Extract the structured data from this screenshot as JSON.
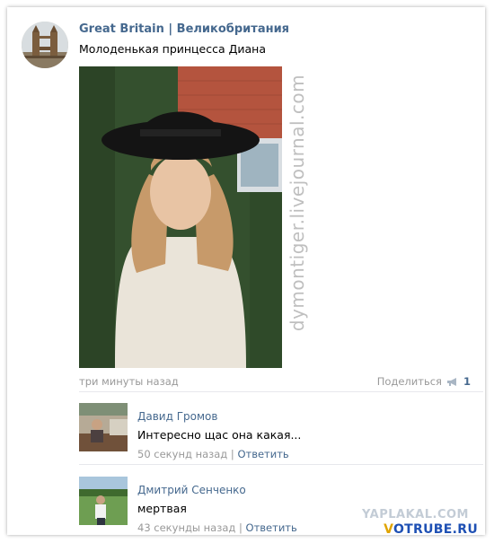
{
  "post": {
    "group_name": "Great Britain | Великобритания",
    "text": "Молоденькая принцесса Диана",
    "photo_watermark": "dymontiger.livejournal.com",
    "time": "три минуты назад",
    "share_label": "Поделиться",
    "share_count": "1"
  },
  "comments": [
    {
      "author": "Давид Громов",
      "text": "Интересно щас она какая...",
      "time": "50 секунд назад",
      "separator": "|",
      "reply_label": "Ответить"
    },
    {
      "author": "Дмитрий Сенченко",
      "text": "мертвая",
      "time": "43 секунды назад",
      "separator": "|",
      "reply_label": "Ответить"
    }
  ],
  "watermarks": {
    "yaplakal": "YAPLAKAL.COM",
    "votrube_v": "V",
    "votrube_rest": "OTRUBE.RU"
  },
  "colors": {
    "link_blue": "#45688e",
    "meta_gray": "#999999",
    "votrube_blue": "#1e50b4",
    "votrube_yellow": "#e0a400"
  }
}
